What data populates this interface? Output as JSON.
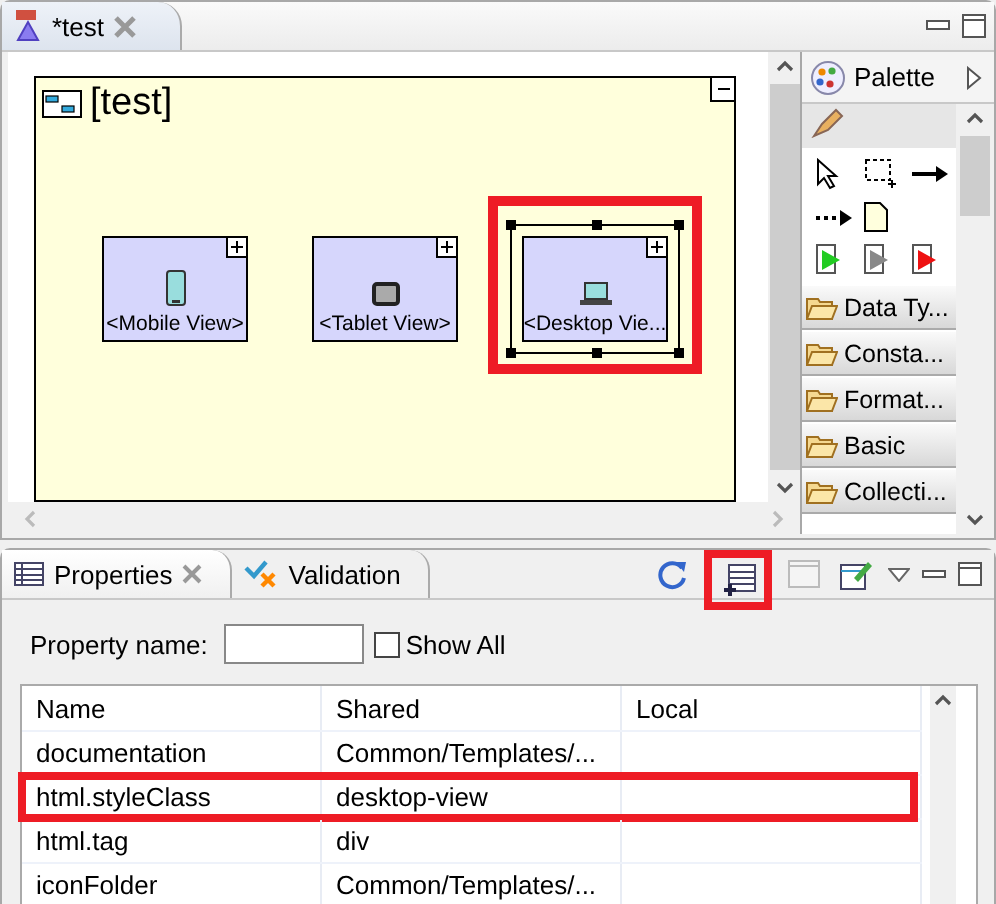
{
  "editor": {
    "tab": {
      "label": "*test",
      "selected": true
    }
  },
  "diagram": {
    "title": "[test]",
    "nodes": [
      {
        "label": "<Mobile View>",
        "kind": "phone",
        "selected": false,
        "highlighted": false
      },
      {
        "label": "<Tablet View>",
        "kind": "tablet",
        "selected": false,
        "highlighted": false
      },
      {
        "label": "<Desktop Vie...",
        "kind": "laptop",
        "selected": true,
        "highlighted": true
      }
    ]
  },
  "palette": {
    "title": "Palette",
    "drawers": [
      {
        "label": "Data Ty..."
      },
      {
        "label": "Consta..."
      },
      {
        "label": "Format..."
      },
      {
        "label": "Basic"
      },
      {
        "label": "Collecti..."
      }
    ]
  },
  "properties": {
    "tabs": [
      {
        "label": "Properties",
        "selected": true,
        "closable": true
      },
      {
        "label": "Validation",
        "selected": false,
        "closable": false
      }
    ],
    "toolbar": [
      {
        "kind": "refresh",
        "highlighted": false
      },
      {
        "kind": "add",
        "highlighted": true
      },
      {
        "kind": "blank",
        "highlighted": false
      },
      {
        "kind": "edit",
        "highlighted": false
      }
    ],
    "filter": {
      "label": "Property name:",
      "show_all": {
        "label": "Show All",
        "checked": false
      }
    },
    "table": {
      "columns": [
        "Name",
        "Shared",
        "Local"
      ],
      "rows": [
        {
          "name": "documentation",
          "shared": "Common/Templates/...",
          "highlighted": false
        },
        {
          "name": "html.styleClass",
          "shared": "desktop-view",
          "highlighted": true
        },
        {
          "name": "html.tag",
          "shared": "div",
          "highlighted": false
        },
        {
          "name": "iconFolder",
          "shared": "Common/Templates/...",
          "highlighted": false
        }
      ]
    }
  }
}
